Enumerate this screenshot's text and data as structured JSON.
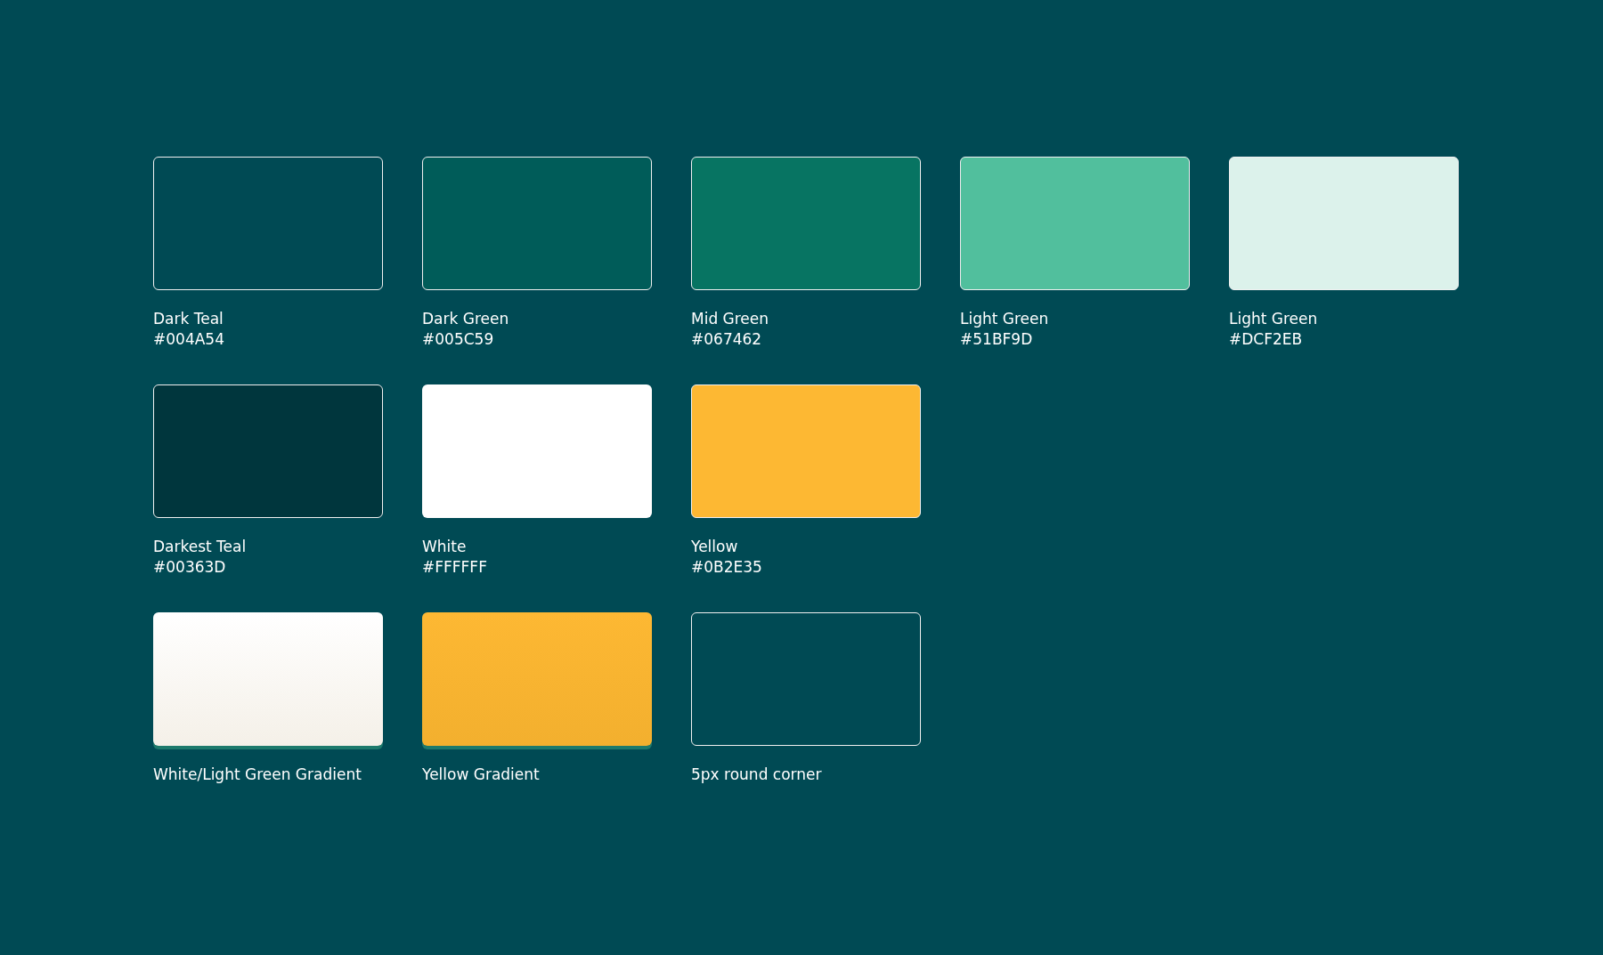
{
  "rows": [
    {
      "swatches": [
        {
          "kind": "solid",
          "color": "#004a54",
          "bordered": true,
          "name": "Dark Teal",
          "hex": "#004A54"
        },
        {
          "kind": "solid",
          "color": "#005c59",
          "bordered": true,
          "name": "Dark Green",
          "hex": "#005C59"
        },
        {
          "kind": "solid",
          "color": "#077462",
          "bordered": true,
          "name": "Mid Green",
          "hex": "#067462"
        },
        {
          "kind": "solid",
          "color": "#51bf9d",
          "bordered": true,
          "name": "Light Green",
          "hex": "#51BF9D"
        },
        {
          "kind": "solid",
          "color": "#dcf2eb",
          "bordered": true,
          "name": "Light Green",
          "hex": "#DCF2EB"
        }
      ]
    },
    {
      "swatches": [
        {
          "kind": "solid",
          "color": "#00363d",
          "bordered": true,
          "name": "Darkest Teal",
          "hex": "#00363D"
        },
        {
          "kind": "solid",
          "color": "#ffffff",
          "bordered": false,
          "name": "White",
          "hex": "#FFFFFF"
        },
        {
          "kind": "solid",
          "color": "#fdb833",
          "bordered": true,
          "name": "Yellow",
          "hex": "#0B2E35"
        }
      ]
    },
    {
      "swatches": [
        {
          "kind": "gradient",
          "color": "#ffffff",
          "bordered": false,
          "name": "White/Light Green Gradient"
        },
        {
          "kind": "gradient",
          "color": "#fdb833",
          "bordered": false,
          "name": "Yellow Gradient"
        },
        {
          "kind": "outline",
          "color": "#004a54",
          "bordered": true,
          "name": "5px round corner"
        }
      ]
    }
  ]
}
